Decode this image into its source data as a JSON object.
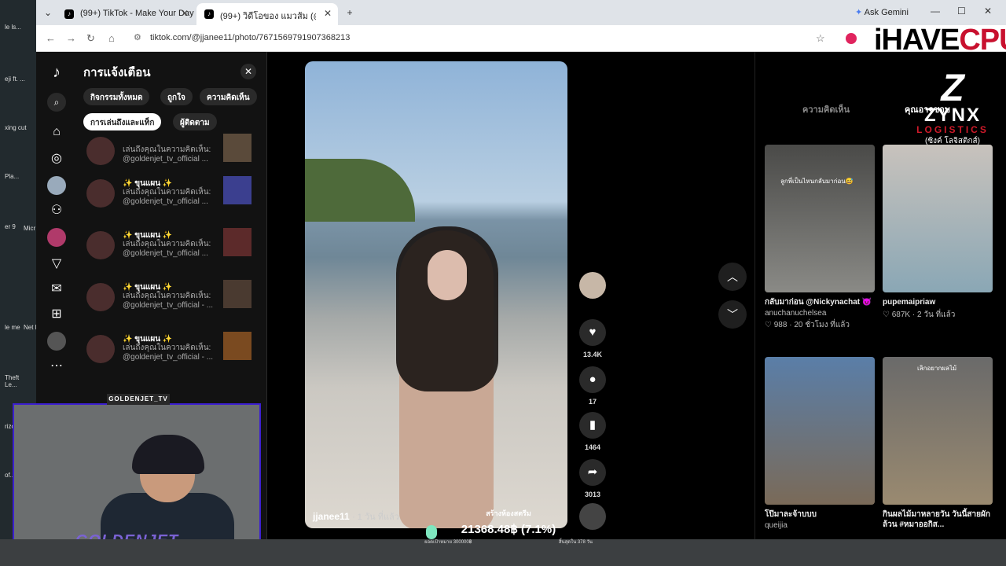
{
  "desktop": {
    "icons": [
      {
        "label": "le ls..."
      },
      {
        "label": "eji ft. ..."
      },
      {
        "label": "xing cut"
      },
      {
        "label": "Pla..."
      },
      {
        "label": "er 9"
      },
      {
        "label": "Micr E"
      },
      {
        "label": "le me"
      },
      {
        "label": "Net Lau"
      },
      {
        "label": "Theft Le..."
      },
      {
        "label": "rizo"
      },
      {
        "label": "of..."
      }
    ]
  },
  "browser": {
    "tabs": [
      {
        "label": "(99+) TikTok - Make Your Day"
      },
      {
        "label": "(99+) วิดีโอของ แมวส้ม (@jjanee11"
      }
    ],
    "new_tab": "+",
    "ask_gemini": "Ask Gemini",
    "window_min": "—",
    "window_max": "☐",
    "window_close": "✕",
    "url": "tiktok.com/@jjanee11/photo/7671569791907368213"
  },
  "tiktok": {
    "notifications": {
      "title": "การแจ้งเตือน",
      "close": "✕",
      "chips": [
        "กิจกรรมทั้งหมด",
        "ถูกใจ",
        "ความคิดเห็น",
        "การเล่นถึงและแท็ก",
        "ผู้ติดตาม"
      ],
      "items": [
        {
          "name": "",
          "text": "เล่นถึงคุณในความคิดเห็น: @goldenjet_tv_official ..."
        },
        {
          "name": "✨ ขุนแผน ✨",
          "text": "เล่นถึงคุณในความคิดเห็น: @goldenjet_tv_official ..."
        },
        {
          "name": "✨ ขุนแผน ✨",
          "text": "เล่นถึงคุณในความคิดเห็น: @goldenjet_tv_official ..."
        },
        {
          "name": "✨ ขุนแผน ✨",
          "text": "เล่นถึงคุณในความคิดเห็น: @goldenjet_tv_official - ..."
        },
        {
          "name": "✨ ขุนแผน ✨",
          "text": "เล่นถึงคุณในความคิดเห็น: @goldenjet_tv_official - ..."
        }
      ]
    },
    "post": {
      "author": "jjanee11",
      "time": "· 1 วัน ที่แล้ว",
      "likes": "13.4K",
      "comments": "17",
      "saves": "1464",
      "shares": "3013"
    },
    "right_panel": {
      "tabs": [
        "ความคิดเห็น",
        "คุณอาจชอบ"
      ],
      "cards": [
        {
          "caption": "กลับมาก่อน @Nickynachat 😈",
          "author": "anuchanuchelsea",
          "meta": "♡ 988 · 20 ชั่วโมง ที่แล้ว",
          "overlay": "ลูกพี่เป็นไหนกลับมาก่อน😅"
        },
        {
          "caption": "pupemaipriaw",
          "author": "",
          "meta": "♡ 687K · 2 วัน ที่แล้ว",
          "overlay": ""
        },
        {
          "caption": "โป๊มาละจ้าบบบ",
          "author": "queijia",
          "meta": "",
          "overlay": ""
        },
        {
          "caption": "กินผลไม้มาหลายวัน วันนี้สายผักล้วน #หมาออกิส...",
          "author": "",
          "meta": "",
          "overlay": "เลิกอยากผลไม้"
        }
      ]
    }
  },
  "overlays": {
    "watermark_main": "iHAVE",
    "watermark_accent": "CPU",
    "sponsor_letter": "Z",
    "sponsor_name": "ZYNX",
    "sponsor_tag": "LOGISTICS",
    "sponsor_thai": "(ซิงค์ โลจิสติกส์)",
    "streamer_label": "GOLDENJET_TV",
    "streamer_name": "GOLDENJET",
    "donation_title": "สร้างห้องสตรีม",
    "donation_amount": "21368.48฿ (7.1%)",
    "donation_left": "ยอดเป้าหมาย 300000฿",
    "donation_right": "สิ้นสุดใน 378 วัน"
  }
}
